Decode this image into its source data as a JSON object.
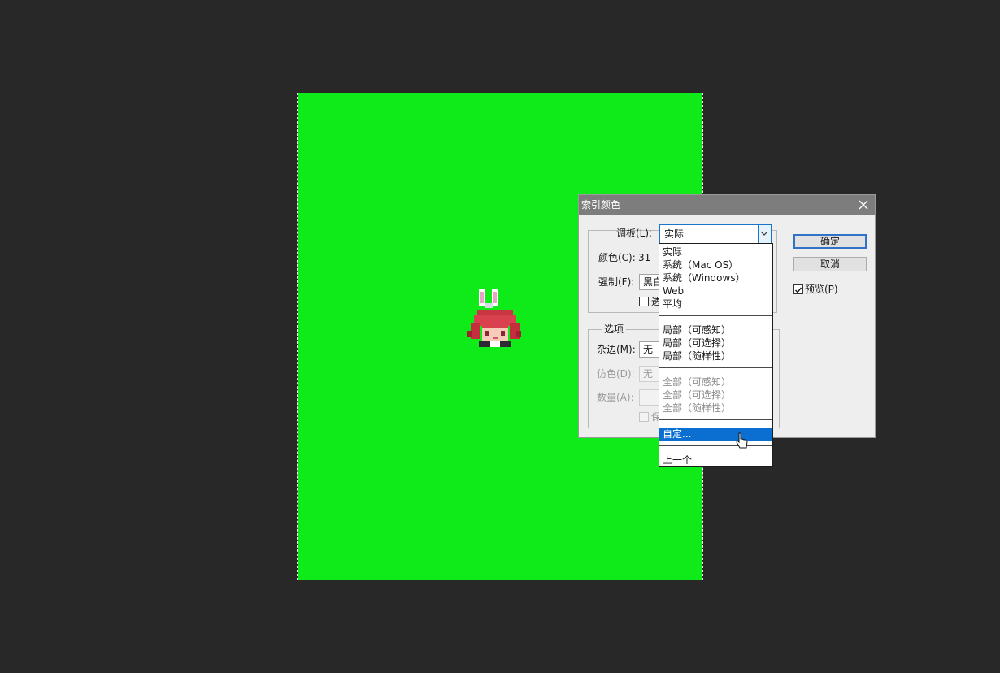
{
  "dialog": {
    "title": "索引颜色",
    "palette_label": "调板(L):",
    "palette_value": "实际",
    "colors_label": "颜色(C):",
    "colors_value": "31",
    "forced_label": "强制(F):",
    "forced_value": "黑白",
    "transparency_label": "透",
    "options_group": "选项",
    "matte_label": "杂边(M):",
    "matte_value": "无",
    "dither_label": "仿色(D):",
    "dither_value": "无",
    "amount_label": "数量(A):",
    "preserve_label": "保",
    "ok_button": "确定",
    "cancel_button": "取消",
    "preview_label": "预览(P)",
    "preview_checked": true
  },
  "palette_options": [
    {
      "label": "实际",
      "enabled": true
    },
    {
      "label": "系统（Mac OS）",
      "enabled": true
    },
    {
      "label": "系统（Windows）",
      "enabled": true
    },
    {
      "label": "Web",
      "enabled": true
    },
    {
      "label": "平均",
      "enabled": true
    },
    {
      "label": "局部（可感知）",
      "enabled": true
    },
    {
      "label": "局部（可选择）",
      "enabled": true
    },
    {
      "label": "局部（随样性）",
      "enabled": true
    },
    {
      "label": "全部（可感知）",
      "enabled": false
    },
    {
      "label": "全部（可选择）",
      "enabled": false
    },
    {
      "label": "全部（随样性）",
      "enabled": false
    },
    {
      "label": "自定...",
      "enabled": true,
      "highlighted": true
    },
    {
      "label": "上一个",
      "enabled": true
    }
  ],
  "colors": {
    "workspace": "#282828",
    "canvas": "#0fea19",
    "title_bar": "#7d7d7d",
    "highlight": "#0a6fd0"
  }
}
